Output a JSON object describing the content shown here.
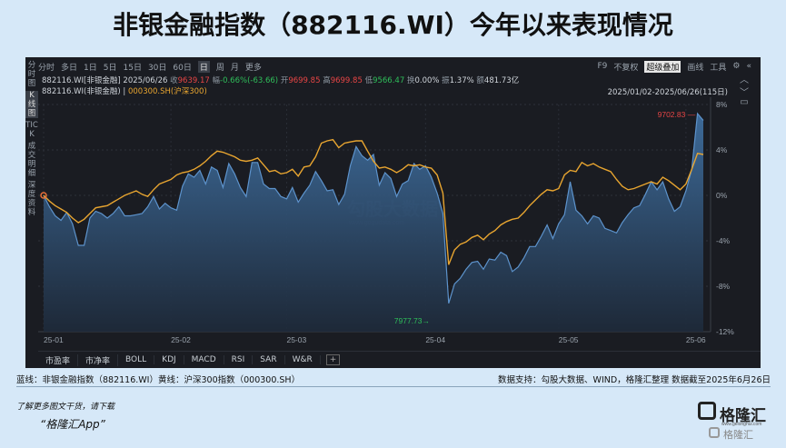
{
  "title": "非银金融指数（882116.WI）今年以来表现情况",
  "toolbar": {
    "left": [
      "分时",
      "多日",
      "1日",
      "5日",
      "15日",
      "30日",
      "60日",
      "日",
      "周",
      "月",
      "更多"
    ],
    "active": "日",
    "right": [
      "F9",
      "不复权",
      "超级叠加",
      "画线",
      "工具",
      "⚙",
      "«"
    ],
    "highlighted": "超级叠加"
  },
  "left_strip": [
    "分时图",
    "K线图",
    "TICK",
    "成交明细",
    "深度资料"
  ],
  "info": {
    "name": "882116.WI[非银金融]",
    "date": "2025/06/26",
    "close_label": "收",
    "close": "9639.17",
    "change_label": "幅",
    "change": "-0.66%(-63.66)",
    "open_label": "开",
    "open": "9699.85",
    "high_label": "高",
    "high": "9699.85",
    "low_label": "低",
    "low": "9566.47",
    "turnover_label": "换",
    "turnover": "0.00%",
    "amplitude_label": "振",
    "amplitude": "1.37%",
    "amount_label": "额",
    "amount": "481.73亿"
  },
  "legend": {
    "series1": "882116.WI(非银金融)",
    "series2": "000300.SH(沪深300)"
  },
  "range": "2025/01/02-2025/06/26(115日)",
  "bottom_tabs": [
    "市盈率",
    "市净率",
    "BOLL",
    "KDJ",
    "MACD",
    "RSI",
    "SAR",
    "W&R",
    "+"
  ],
  "footer_left": "蓝线：非银金融指数（882116.WI）黄线：沪深300指数（000300.SH）",
  "footer_right": "数据支持：勾股大数据、WIND，格隆汇整理 数据截至2025年6月26日",
  "promo_line1": "了解更多图文干货，请下载",
  "promo_line2": "“格隆汇App”",
  "brand": {
    "name": "格隆汇",
    "url": "www.gelonghui.com",
    "sub": "格隆汇"
  },
  "watermark": "勾股大数据",
  "watermark_url": "www.gogudata.com",
  "colors": {
    "series1": "#4a86c5",
    "series2": "#e8a530",
    "max_label": "#e64545",
    "min_label": "#2fbf5a"
  },
  "chart_data": {
    "type": "area",
    "y_unit": "%",
    "ylim": [
      -12,
      8
    ],
    "yticks": [
      "8%",
      "4%",
      "0%",
      "-4%",
      "-8%",
      "-12%"
    ],
    "xticks": [
      "25-01",
      "25-02",
      "25-03",
      "25-04",
      "25-05",
      "25-06"
    ],
    "max_label": "9702.83",
    "min_label": "7977.73",
    "series": [
      {
        "name": "882116.WI(非银金融)",
        "values": [
          0,
          -1.0,
          -1.8,
          -2.2,
          -1.5,
          -2.5,
          -4.4,
          -4.4,
          -2.0,
          -1.4,
          -1.6,
          -2.0,
          -1.6,
          -1.0,
          -1.8,
          -1.8,
          -1.7,
          -1.6,
          -1.0,
          -0.1,
          -1.2,
          -0.7,
          -1.1,
          -1.3,
          0.8,
          1.9,
          1.6,
          2.2,
          1.0,
          2.5,
          2.2,
          0.7,
          2.8,
          1.9,
          0.7,
          -0.1,
          2.9,
          2.9,
          1.0,
          0.6,
          0.6,
          -0.1,
          -0.3,
          0.7,
          -0.6,
          0.2,
          0.9,
          2.1,
          1.3,
          0.4,
          0.5,
          -0.8,
          0.1,
          2.6,
          4.3,
          3.5,
          3.1,
          3.6,
          0.9,
          2.0,
          1.5,
          -0.1,
          1.0,
          1.3,
          2.8,
          2.3,
          2.6,
          1.6,
          0.2,
          -1.6,
          -9.5,
          -7.8,
          -7.3,
          -6.5,
          -5.9,
          -5.8,
          -6.5,
          -5.6,
          -5.7,
          -5.0,
          -5.3,
          -6.7,
          -6.3,
          -5.5,
          -4.5,
          -4.5,
          -3.6,
          -2.6,
          -3.8,
          -2.5,
          -1.7,
          1.2,
          -1.3,
          -1.8,
          -2.5,
          -1.8,
          -2.0,
          -2.9,
          -3.1,
          -3.3,
          -2.4,
          -1.7,
          -1.1,
          -0.9,
          0.1,
          1.2,
          0.5,
          1.2,
          -0.3,
          -1.4,
          -1.0,
          0.4,
          2.3,
          7.2,
          6.6
        ]
      },
      {
        "name": "000300.SH(沪深300)",
        "values": [
          0,
          -0.5,
          -0.9,
          -1.2,
          -1.5,
          -2.0,
          -2.4,
          -2.1,
          -1.6,
          -1.1,
          -1.0,
          -0.9,
          -0.6,
          -0.3,
          0.0,
          0.2,
          0.4,
          0.1,
          -0.1,
          0.5,
          1.0,
          1.2,
          1.4,
          1.8,
          2.0,
          2.1,
          2.3,
          2.6,
          3.0,
          3.5,
          3.9,
          3.8,
          3.6,
          3.4,
          3.1,
          3.0,
          3.1,
          3.3,
          2.7,
          2.1,
          2.2,
          1.9,
          2.0,
          2.3,
          1.7,
          2.5,
          2.6,
          3.4,
          4.6,
          4.8,
          4.9,
          4.2,
          4.6,
          4.7,
          4.8,
          4.8,
          3.9,
          3.0,
          2.4,
          2.5,
          2.3,
          2.0,
          2.3,
          2.7,
          2.6,
          2.7,
          2.5,
          2.4,
          1.8,
          0.2,
          -6.1,
          -4.8,
          -4.3,
          -4.1,
          -3.7,
          -3.5,
          -3.9,
          -3.4,
          -3.1,
          -2.6,
          -2.3,
          -2.1,
          -2.0,
          -1.5,
          -0.9,
          -0.4,
          0.1,
          0.5,
          0.4,
          0.6,
          1.8,
          2.2,
          2.1,
          2.9,
          2.6,
          2.8,
          2.5,
          2.3,
          2.1,
          1.4,
          0.8,
          0.5,
          0.6,
          0.8,
          1.0,
          1.2,
          1.0,
          1.6,
          1.3,
          0.9,
          0.5,
          1.0,
          2.3,
          3.7,
          3.6
        ]
      }
    ]
  }
}
